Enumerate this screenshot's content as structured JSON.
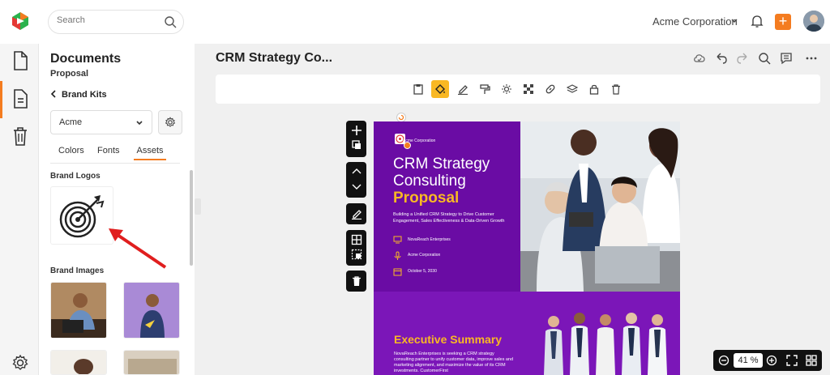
{
  "header": {
    "search_placeholder": "Search",
    "organization": "Acme Corporation",
    "add_label": "+"
  },
  "panel": {
    "title": "Documents",
    "subtitle": "Proposal",
    "brand_kits_label": "Brand Kits",
    "kit_selected": "Acme",
    "tabs": [
      {
        "label": "Colors"
      },
      {
        "label": "Fonts"
      },
      {
        "label": "Assets",
        "active": true
      }
    ],
    "brand_logos_label": "Brand Logos",
    "brand_images_label": "Brand Images"
  },
  "document": {
    "title": "CRM Strategy Co...",
    "zoom": "41",
    "zoom_unit": "%"
  },
  "page": {
    "company": "Acme Corporation",
    "heading_line1": "CRM Strategy",
    "heading_line2": "Consulting",
    "heading_accent": "Proposal",
    "description": "Building a Unified CRM Strategy to Drive Customer Engagement, Sales Effectiveness & Data-Driven Growth",
    "client": "NovaReach Enterprises",
    "presenter": "Acme Corporation",
    "date": "October 5, 2030",
    "exec_heading": "Executive Summary",
    "exec_text": "NovaReach Enterprises is seeking a CRM strategy consulting partner to unify customer data, improve sales and marketing alignment, and maximize the value of its CRM investments. CustomerFirst"
  },
  "colors": {
    "accent": "#f47c20",
    "highlight": "#f9b824",
    "page_purple": "#6a0ca4",
    "page_purple_light": "#7b16b8"
  }
}
